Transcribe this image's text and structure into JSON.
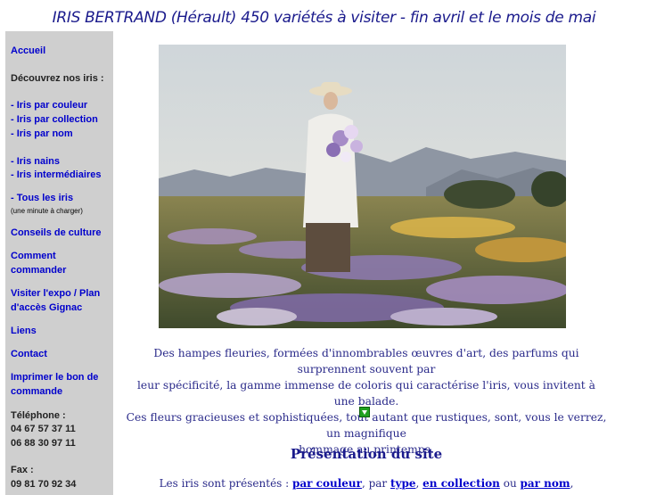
{
  "header": {
    "title": "IRIS BERTRAND (Hérault) 450 variétés à visiter - fin avril et le mois de mai"
  },
  "sidebar": {
    "accueil": "Accueil",
    "decouvrez": "Découvrez nos iris :",
    "par_couleur": "- Iris par couleur",
    "par_collection": "- Iris par collection",
    "par_nom": "- Iris par nom",
    "nains": "- Iris nains",
    "intermediaires": "- Iris intermédiaires",
    "tous": "- Tous les iris",
    "tous_note": "(une minute à charger)",
    "conseils": "Conseils de culture",
    "comment_1": "Comment",
    "comment_2": "commander",
    "visiter_1": "Visiter l'expo / Plan",
    "visiter_2": "d'accès Gignac",
    "liens": "Liens",
    "contact": "Contact",
    "imprimer_1": "Imprimer le bon de",
    "imprimer_2": "commande",
    "telephone_label": "Téléphone :",
    "telephone_1": "04 67 57 37 11",
    "telephone_2": "06 88 30 97 11",
    "fax_label": "Fax :",
    "fax_1": "09 81 70 92 34"
  },
  "main": {
    "caption_1": "Des hampes fleuries, formées d'innombrables œuvres d'art, des parfums qui surprennent souvent par",
    "caption_2": "leur spécificité, la gamme immense de coloris qui caractérise l'iris, vous invitent à une balade.",
    "caption_3": "Ces fleurs gracieuses et sophistiquées, tout autant que rustiques, sont, vous le verrez, un magnifique",
    "caption_4": "hommage au printemps.",
    "presentation_title": "Présentation du site",
    "intro_prefix": "Les iris sont présentés : ",
    "link_couleur": "par couleur",
    "sep_1": ", par ",
    "link_type": "type",
    "sep_2": ", ",
    "link_collection": "en collection",
    "sep_3": " ou ",
    "link_nom": "par nom",
    "sep_4": ","
  },
  "colors": {
    "header_text": "#1a1a8c",
    "link": "#0000cc",
    "sidebar_bg": "#cfcfcf",
    "arrow_button": "#20a020"
  },
  "icons": {
    "scroll_down": "green-down-arrow-icon"
  }
}
